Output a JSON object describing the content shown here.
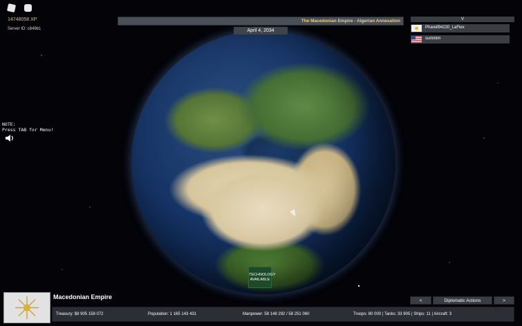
{
  "hud": {
    "xp": "14748058 XP",
    "server_id": "Server ID: c849b1",
    "note_line1": "NOTE:",
    "note_line2": "Press TAB for Menu!"
  },
  "banner": {
    "text": "The Macedonian Empire - Algerian Annexation",
    "date": "April 4, 2034"
  },
  "player_list": {
    "toggle": "V",
    "players": [
      {
        "name": "Pharell94220_LaFlex",
        "flag": "macedonian-empire-flag"
      },
      {
        "name": "suminim",
        "flag": "usa-flag"
      }
    ]
  },
  "map": {
    "tech_line1": "TECHNOLOGY",
    "tech_line2": "AVAILABLE"
  },
  "nation": {
    "name": "Macedonian Empire",
    "flag_icon": "vergina-sun-flag"
  },
  "stats": {
    "treasury_label": "Treasury:",
    "treasury": "$8 905 158 072",
    "population_label": "Population:",
    "population": "1 165 143 431",
    "manpower_label": "Manpower:",
    "manpower": "58 148 292",
    "manpower_sep": "/",
    "manpower_max": "58 251 060",
    "troops_label": "Troops:",
    "troops": "80 000",
    "tanks_label": "Tanks:",
    "tanks": "33 905",
    "ships_label": "Ships:",
    "ships": "11",
    "aircraft_label": "Aircraft:",
    "aircraft": "3",
    "sep": "|"
  },
  "diplomacy": {
    "prev": "<",
    "label": "Diplomatic Actions",
    "next": ">"
  },
  "colors": {
    "accent_gold": "#f0d070",
    "panel": "#3a3d44",
    "tech_green": "#1d4b2a"
  }
}
